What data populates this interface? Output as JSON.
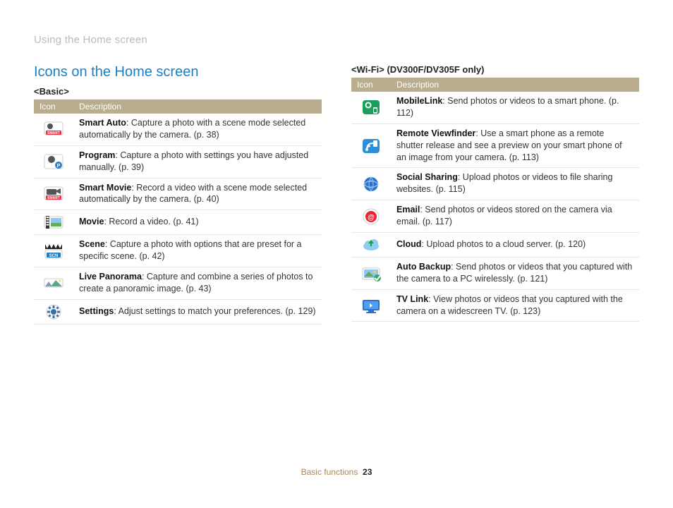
{
  "breadcrumb": "Using the Home screen",
  "section_title": "Icons on the Home screen",
  "basic": {
    "heading": "<Basic>",
    "head_icon": "Icon",
    "head_desc": "Description",
    "rows": [
      {
        "icon": "smart-auto",
        "title": "Smart Auto",
        "rest": ": Capture a photo with a scene mode selected automatically by the camera. (p. 38)"
      },
      {
        "icon": "program",
        "title": "Program",
        "rest": ": Capture a photo with settings you have adjusted manually. (p. 39)"
      },
      {
        "icon": "smart-movie",
        "title": "Smart Movie",
        "rest": ": Record a video with a scene mode selected automatically by the camera. (p. 40)"
      },
      {
        "icon": "movie",
        "title": "Movie",
        "rest": ": Record a video. (p. 41)"
      },
      {
        "icon": "scene",
        "title": "Scene",
        "rest": ": Capture a photo with options that are preset for a specific scene. (p. 42)"
      },
      {
        "icon": "live-panorama",
        "title": "Live Panorama",
        "rest": ": Capture and combine a series of photos to create a panoramic image. (p. 43)"
      },
      {
        "icon": "settings",
        "title": "Settings",
        "rest": ": Adjust settings to match your preferences. (p. 129)"
      }
    ]
  },
  "wifi": {
    "heading": "<Wi-Fi> (DV300F/DV305F only)",
    "head_icon": "Icon",
    "head_desc": "Description",
    "rows": [
      {
        "icon": "mobilelink",
        "title": "MobileLink",
        "rest": ": Send photos or videos to a smart phone. (p. 112)"
      },
      {
        "icon": "remote-viewfinder",
        "title": "Remote Viewfinder",
        "rest": ": Use a smart phone as a remote shutter release and see a preview on your smart phone of an image from your camera. (p. 113)"
      },
      {
        "icon": "social-sharing",
        "title": "Social Sharing",
        "rest": ": Upload photos or videos to file sharing websites. (p. 115)"
      },
      {
        "icon": "email",
        "title": "Email",
        "rest": ": Send photos or videos stored on the camera via email. (p. 117)"
      },
      {
        "icon": "cloud",
        "title": "Cloud",
        "rest": ": Upload photos to a cloud server. (p. 120)"
      },
      {
        "icon": "auto-backup",
        "title": "Auto Backup",
        "rest": ": Send photos or videos that you captured with the camera to a PC wirelessly. (p. 121)"
      },
      {
        "icon": "tv-link",
        "title": "TV Link",
        "rest": ": View photos or videos that you captured with the camera on a widescreen TV. (p. 123)"
      }
    ]
  },
  "footer": {
    "section": "Basic functions",
    "page": "23"
  },
  "icons": {
    "smart-auto": "<svg viewBox='0 0 30 26'><rect x='2' y='3' width='26' height='18' rx='3' fill='#fff' stroke='#ccc'/><circle cx='10' cy='9' r='4' fill='#555'/><rect x='4' y='15' width='22' height='6' rx='1' fill='#e34'/><text x='15' y='20' font-size='5' fill='#fff' text-anchor='middle' font-family='Arial' font-weight='bold'>SMART</text></svg>",
    "program": "<svg viewBox='0 0 30 26'><rect x='2' y='3' width='26' height='20' rx='3' fill='#fff' stroke='#ccc'/><circle cx='12' cy='10' r='5' fill='#555'/><circle cx='22' cy='18' r='5' fill='#2b7ed1'/><text x='22' y='21' font-size='7' fill='#fff' text-anchor='middle' font-family='Arial' font-weight='bold'>P</text></svg>",
    "smart-movie": "<svg viewBox='0 0 30 26'><rect x='2' y='3' width='26' height='18' rx='3' fill='#fff' stroke='#ccc'/><rect x='5' y='6' width='14' height='8' rx='1' fill='#555'/><path d='M19 8 L25 5 L25 13 L19 10 Z' fill='#555'/><rect x='4' y='15' width='22' height='6' rx='1' fill='#e34'/><text x='15' y='20' font-size='5' fill='#fff' text-anchor='middle' font-family='Arial' font-weight='bold'>SMART</text></svg>",
    "movie": "<svg viewBox='0 0 30 26'><rect x='2' y='5' width='26' height='16' rx='2' fill='#fff' stroke='#ccc'/><rect x='4' y='4' width='5' height='18' fill='#333'/><rect x='4.5' y='5' width='4' height='2' fill='#fff'/><rect x='4.5' y='8.5' width='4' height='2' fill='#fff'/><rect x='4.5' y='12' width='4' height='2' fill='#fff'/><rect x='4.5' y='15.5' width='4' height='2' fill='#fff'/><rect x='11' y='7' width='15' height='12' fill='#8cc8f0'/><rect x='11' y='14' width='15' height='5' fill='#6a5'/></svg>",
    "scene": "<svg viewBox='0 0 30 26'><rect x='3' y='3' width='24' height='7' fill='#222'/><path d='M3 3 L6 9 L9 3 L12 9 L15 3 L18 9 L21 3 L24 9 L27 3 Z' fill='#fff'/><rect x='3' y='11' width='24' height='12' rx='2' fill='#fff' stroke='#ccc'/><rect x='5' y='15' width='20' height='7' rx='1' fill='#1a7fc5'/><text x='15' y='21' font-size='6' fill='#fff' text-anchor='middle' font-family='Arial' font-weight='bold'>SCN</text></svg>",
    "live-panorama": "<svg viewBox='0 0 30 26'><rect x='2' y='7' width='26' height='12' rx='2' fill='#fff' stroke='#ccc'/><path d='M3 18 L8 11 L13 18 Z' fill='#7aa0b8'/><path d='M11 18 L18 9 L27 18 Z' fill='#5a8'/><circle cx='24' cy='10' r='1.5' fill='#fc5'/></svg>",
    "settings": "<svg viewBox='0 0 30 26'><circle cx='15' cy='13' r='10' fill='#fff' stroke='#ccc'/><g transform='translate(15,13)'><circle r='4' fill='#3a6ea5'/><g fill='#3a6ea5'><rect x='-1.5' y='-9' width='3' height='4'/><rect x='-1.5' y='5' width='3' height='4'/><rect x='-9' y='-1.5' width='4' height='3'/><rect x='5' y='-1.5' width='4' height='3'/><rect x='-7' y='-7' width='3' height='3' transform='rotate(45 -5.5 -5.5)'/><rect x='4' y='4' width='3' height='3' transform='rotate(45 5.5 5.5)'/><rect x='-7' y='4' width='3' height='3' transform='rotate(45 -5.5 5.5)'/><rect x='4' y='-7' width='3' height='3' transform='rotate(45 5.5 -5.5)'/></g></g></svg>",
    "mobilelink": "<svg viewBox='0 0 30 26'><rect x='3' y='3' width='24' height='20' rx='4' fill='#1aa05a'/><circle cx='11' cy='10' r='4.5' fill='#fff'/><circle cx='11' cy='10' r='2.5' fill='#1aa05a'/><rect x='18' y='13' width='6' height='9' rx='1' fill='#fff'/><rect x='19' y='15' width='4' height='5' fill='#1aa05a'/></svg>",
    "remote-viewfinder": "<svg viewBox='0 0 30 26'><rect x='3' y='3' width='24' height='20' rx='4' fill='#2b8fd9'/><path d='M9 18 Q9 9 18 9' stroke='#fff' stroke-width='2' fill='none'/><path d='M9 18 Q9 13 14 13' stroke='#fff' stroke-width='2' fill='none'/><circle cx='9' cy='18' r='2' fill='#fff'/><rect x='18' y='5' width='6' height='9' rx='1' fill='#fff'/></svg>",
    "social-sharing": "<svg viewBox='0 0 30 26'><circle cx='15' cy='13' r='10' fill='#2b6fd1'/><path d='M5 13 Q15 3 25 13 Q15 23 5 13 Z' fill='none' stroke='#9ec5ef' stroke-width='1'/><path d='M15 3 Q9 13 15 23 Q21 13 15 3 Z' fill='none' stroke='#9ec5ef' stroke-width='1'/><ellipse cx='15' cy='13' rx='10' ry='4' fill='none' stroke='#9ec5ef' stroke-width='1'/><path d='M6 9 Q10 13 8 19' fill='#4a8' opacity='.6'/></svg>",
    "email": "<svg viewBox='0 0 30 26'><circle cx='15' cy='13' r='11' fill='#fff' stroke='#ccc'/><circle cx='15' cy='13' r='8' fill='#e23'/><text x='15' y='17' font-size='10' fill='#fff' text-anchor='middle' font-family='Arial' font-weight='bold'>@</text></svg>",
    "cloud": "<svg viewBox='0 0 30 26'><ellipse cx='15' cy='15' rx='11' ry='6' fill='#8fcdf2'/><circle cx='11' cy='12' r='5' fill='#8fcdf2'/><circle cx='19' cy='11' r='6' fill='#8fcdf2'/><path d='M15 6 L11 11 L14 11 L14 15 L16 15 L16 11 L19 11 Z' fill='#1a9b4a'/></svg>",
    "auto-backup": "<svg viewBox='0 0 30 26'><rect x='3' y='6' width='24' height='16' rx='2' fill='#fff' stroke='#ccc'/><rect x='5' y='8' width='20' height='12' fill='#8cc8f0'/><path d='M5 18 L12 11 L19 18 Z' fill='#6a5'/><circle cx='20' cy='11' r='2' fill='#fc5'/><circle cx='24' cy='20' r='5' fill='#3a6'/><path d='M20 20 L23 23 L28 17' stroke='#fff' stroke-width='2' fill='none'/></svg>",
    "tv-link": "<svg viewBox='0 0 30 26'><rect x='3' y='5' width='24' height='15' rx='2' fill='#2b6fd1'/><rect x='5' y='7' width='20' height='11' fill='#4da0f0'/><rect x='11' y='20' width='8' height='2' fill='#2b6fd1'/><rect x='8' y='22' width='14' height='2' rx='1' fill='#2b6fd1'/><path d='M11 12 L17 12 L14 16 Z' fill='#fff' transform='rotate(-90 14 13)'/></svg>"
  }
}
